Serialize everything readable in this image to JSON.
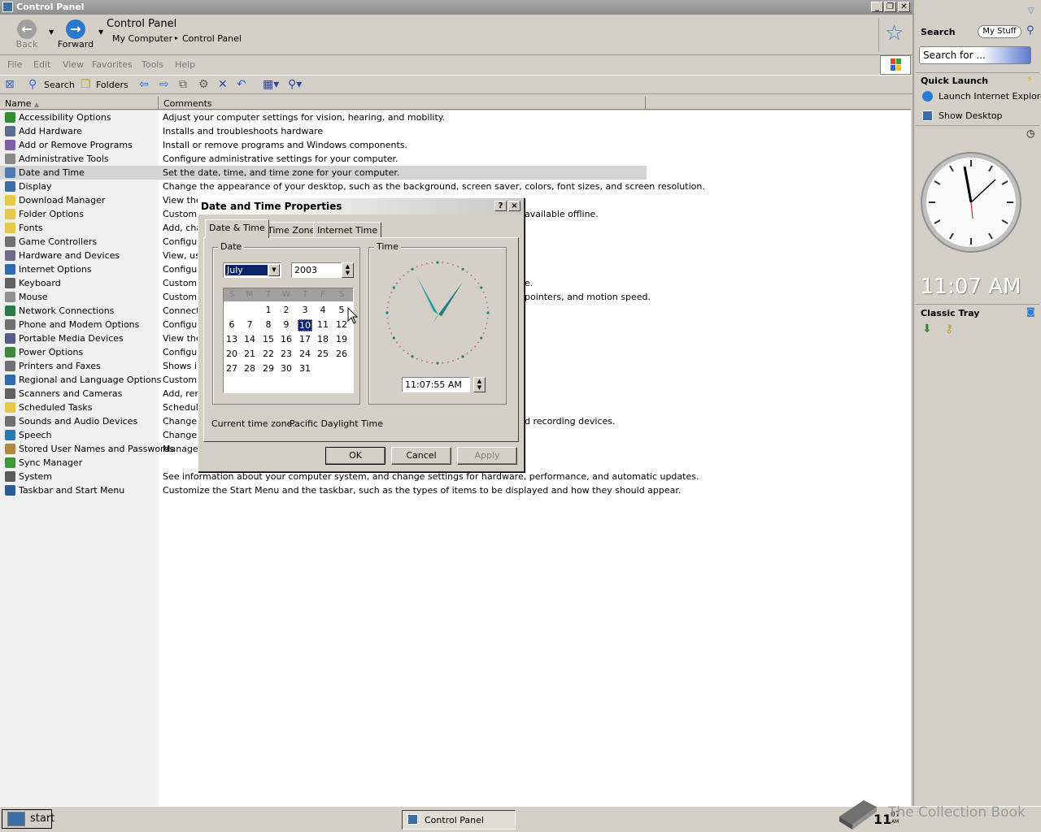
{
  "window": {
    "title": "Control Panel"
  },
  "nav": {
    "back": "Back",
    "forward": "Forward"
  },
  "address": {
    "title": "Control Panel",
    "crumb1": "My Computer",
    "crumb2": "Control Panel"
  },
  "menu": [
    "File",
    "Edit",
    "View",
    "Favorites",
    "Tools",
    "Help"
  ],
  "toolbar": {
    "search": "Search",
    "folders": "Folders"
  },
  "columns": {
    "name": "Name",
    "comments": "Comments"
  },
  "items": [
    {
      "name": "Accessibility Options",
      "comment": "Adjust your computer settings for vision, hearing, and mobility.",
      "color": "#2f8f2f"
    },
    {
      "name": "Add Hardware",
      "comment": "Installs and troubleshoots hardware",
      "color": "#5a6f8f"
    },
    {
      "name": "Add or Remove Programs",
      "comment": "Install or remove programs and Windows components.",
      "color": "#7b5ea7"
    },
    {
      "name": "Administrative Tools",
      "comment": "Configure administrative settings for your computer.",
      "color": "#8a8a8a"
    },
    {
      "name": "Date and Time",
      "comment": "Set the date, time, and time zone for your computer.",
      "color": "#4a7ab0",
      "selected": true
    },
    {
      "name": "Display",
      "comment": "Change the appearance of your desktop, such as the background, screen saver, colors, font sizes, and screen resolution.",
      "color": "#3a6ea5"
    },
    {
      "name": "Download Manager",
      "comment": "View the",
      "color": "#e6c84a"
    },
    {
      "name": "Folder Options",
      "comment": "Customiz",
      "color": "#e6c84a",
      "comment_tail": "available offline."
    },
    {
      "name": "Fonts",
      "comment": "Add, cha",
      "color": "#e6c84a"
    },
    {
      "name": "Game Controllers",
      "comment": "Configur",
      "color": "#707070"
    },
    {
      "name": "Hardware and Devices",
      "comment": "View, use",
      "color": "#6a6a8a"
    },
    {
      "name": "Internet Options",
      "comment": "Configur",
      "color": "#2a6ab0"
    },
    {
      "name": "Keyboard",
      "comment": "Customiz",
      "color": "#606060",
      "comment_tail": "e."
    },
    {
      "name": "Mouse",
      "comment": "Customiz",
      "color": "#909090",
      "comment_tail": "pointers, and motion speed."
    },
    {
      "name": "Network Connections",
      "comment": "Connects",
      "color": "#2a7a4a"
    },
    {
      "name": "Phone and Modem Options",
      "comment": "Configur",
      "color": "#707070"
    },
    {
      "name": "Portable Media Devices",
      "comment": "View the",
      "color": "#5a5a8a"
    },
    {
      "name": "Power Options",
      "comment": "Configur",
      "color": "#3a8a3a"
    },
    {
      "name": "Printers and Faxes",
      "comment": "Shows in",
      "color": "#707070"
    },
    {
      "name": "Regional and Language Options",
      "comment": "Customiz",
      "color": "#2a6ab0"
    },
    {
      "name": "Scanners and Cameras",
      "comment": "Add, rem",
      "color": "#606060"
    },
    {
      "name": "Scheduled Tasks",
      "comment": "Schedule",
      "color": "#e6c84a"
    },
    {
      "name": "Sounds and Audio Devices",
      "comment": "Change t",
      "color": "#707070",
      "comment_tail": "d recording devices."
    },
    {
      "name": "Speech",
      "comment": "Change s",
      "color": "#2a7ab0"
    },
    {
      "name": "Stored User Names and Passwords",
      "comment": "Manages",
      "color": "#b08a3a"
    },
    {
      "name": "Sync Manager",
      "comment": "",
      "color": "#3a9a3a"
    },
    {
      "name": "System",
      "comment": "See information about your computer system, and change settings for hardware, performance, and automatic updates.",
      "color": "#5a5a5a"
    },
    {
      "name": "Taskbar and Start Menu",
      "comment": "Customize the Start Menu and the taskbar, such as the types of items to be displayed and how they should appear.",
      "color": "#2a5a9a"
    }
  ],
  "dialog": {
    "title": "Date and Time Properties",
    "help": "?",
    "close": "×",
    "tabs": [
      "Date & Time",
      "Time Zone",
      "Internet Time"
    ],
    "date_group": "Date",
    "time_group": "Time",
    "month": "July",
    "year": "2003",
    "weekdays": [
      "S",
      "M",
      "T",
      "W",
      "T",
      "F",
      "S"
    ],
    "days": [
      "",
      "",
      "1",
      "2",
      "3",
      "4",
      "5",
      "6",
      "7",
      "8",
      "9",
      "10",
      "11",
      "12",
      "13",
      "14",
      "15",
      "16",
      "17",
      "18",
      "19",
      "20",
      "21",
      "22",
      "23",
      "24",
      "25",
      "26",
      "27",
      "28",
      "29",
      "30",
      "31"
    ],
    "selected_day": "10",
    "time": "11:07:55 AM",
    "tz_label": "Current time zone:",
    "tz_value": "Pacific Daylight Time",
    "ok": "OK",
    "cancel": "Cancel",
    "apply": "Apply"
  },
  "sidebar": {
    "search_label": "Search",
    "my_stuff": "My Stuff",
    "search_placeholder": "Search for ...",
    "quick_launch": "Quick Launch",
    "ql_items": [
      "Launch Internet Explore",
      "Show Desktop"
    ],
    "clock_time": "11:07 AM",
    "classic_tray": "Classic Tray"
  },
  "taskbar": {
    "start": "start",
    "task": "Control Panel",
    "clock_hour": "11",
    "clock_min": "07",
    "clock_ampm": "AM",
    "watermark": "The Collection Book"
  },
  "colors": {
    "dialog_title": "#1a1a1a",
    "selection": "#0a246a"
  }
}
